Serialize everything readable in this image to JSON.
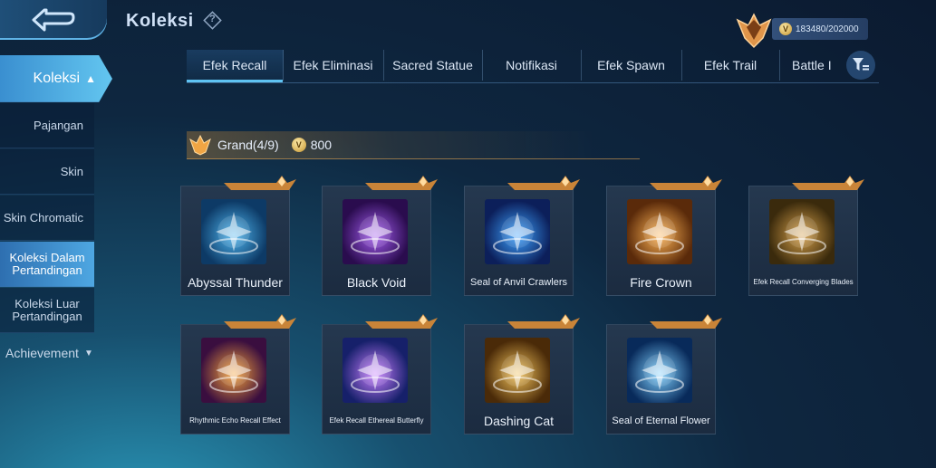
{
  "header": {
    "title": "Koleksi",
    "help_symbol": "?",
    "currency_value": "183480/202000"
  },
  "sidebar": {
    "main_label": "Koleksi",
    "items": [
      {
        "label": "Pajangan"
      },
      {
        "label": "Skin"
      },
      {
        "label": "Skin Chromatic"
      },
      {
        "label": "Koleksi Dalam Pertandingan",
        "active": true
      },
      {
        "label": "Koleksi Luar Pertandingan"
      }
    ],
    "achievement_label": "Achievement"
  },
  "tabs": [
    {
      "label": "Efek Recall",
      "active": true
    },
    {
      "label": "Efek Eliminasi"
    },
    {
      "label": "Sacred Statue"
    },
    {
      "label": "Notifikasi"
    },
    {
      "label": "Efek Spawn"
    },
    {
      "label": "Efek Trail"
    },
    {
      "label": "Battle I"
    }
  ],
  "grand": {
    "label": "Grand(4/9)",
    "points": "800"
  },
  "cards": [
    {
      "name": "Abyssal Thunder",
      "icon": "lightning-creature-icon",
      "palette": [
        "#0d3a66",
        "#4fb6f0"
      ]
    },
    {
      "name": "Black Void",
      "icon": "dark-orb-icon",
      "palette": [
        "#2a0c4e",
        "#a45cf0"
      ]
    },
    {
      "name": "Seal of Anvil Crawlers",
      "icon": "blue-seal-icon",
      "palette": [
        "#0c1f5a",
        "#3da2ff"
      ]
    },
    {
      "name": "Fire Crown",
      "icon": "fire-crown-icon",
      "palette": [
        "#5a2a0a",
        "#ffb454"
      ]
    },
    {
      "name": "Efek Recall Converging Blades",
      "icon": "golden-blades-icon",
      "palette": [
        "#3a2a0c",
        "#d6a04a"
      ]
    },
    {
      "name": "Rhythmic Echo Recall Effect",
      "icon": "rhythm-star-icon",
      "palette": [
        "#3a0e3f",
        "#f6a23a"
      ]
    },
    {
      "name": "Efek Recall Ethereal Butterfly",
      "icon": "ethereal-butterfly-icon",
      "palette": [
        "#16206a",
        "#c77dff"
      ]
    },
    {
      "name": "Dashing Cat",
      "icon": "dashing-cat-icon",
      "palette": [
        "#4a2a08",
        "#f2c25a"
      ]
    },
    {
      "name": "Seal of Eternal Flower",
      "icon": "snow-flower-icon",
      "palette": [
        "#082a5a",
        "#7fd0ff"
      ]
    }
  ]
}
